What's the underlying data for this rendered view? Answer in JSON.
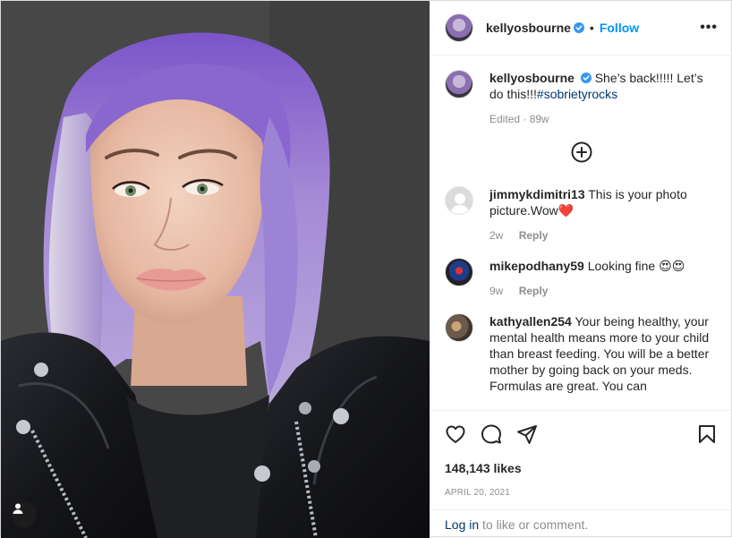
{
  "post": {
    "username": "kellyosbourne",
    "follow_label": "Follow",
    "separator": "•",
    "more_label": "•••",
    "caption_text": "She’s back!!!!! Let’s do this!!!",
    "caption_hashtag": "#sobrietyrocks",
    "caption_meta": "Edited · 89w",
    "likes": "148,143 likes",
    "date": "APRIL 20, 2021",
    "login_link": "Log in",
    "login_suffix": " to like or comment."
  },
  "comments": [
    {
      "username": "jimmykdimitri13",
      "text": "This is your photo picture.Wow❤️",
      "age": "2w",
      "reply": "Reply"
    },
    {
      "username": "mikepodhany59",
      "text": "Looking fine 😍😍",
      "age": "9w",
      "reply": "Reply"
    },
    {
      "username": "kathyallen254",
      "text": "Your being healthy, your mental health means more to your child than breast feeding. You will be a better mother by going back on your meds. Formulas are great. You can",
      "age": "",
      "reply": ""
    }
  ],
  "icons": {
    "verified": "verified-badge-icon",
    "tag": "user-tag-icon",
    "load_more": "plus-circle-icon",
    "like": "heart-icon",
    "comment": "comment-icon",
    "share": "share-icon",
    "save": "bookmark-icon"
  },
  "colors": {
    "accent": "#0095f6",
    "hashtag": "#00376b",
    "muted": "#8e8e8e",
    "hair": "#9c7fd0",
    "jacket": "#1a1b20"
  }
}
